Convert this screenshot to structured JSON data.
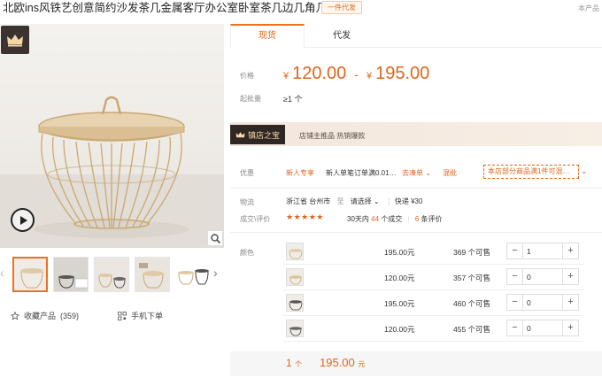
{
  "header": {
    "title": "北欧ins风铁艺创意简约沙发茶几金属客厅办公室卧室茶几边几角几",
    "dropship_tag": "一件代发",
    "this_product": "本产品"
  },
  "gallery": {
    "favorite_label": "收藏产品",
    "favorite_count": "(359)",
    "mobile_order_label": "手机下单",
    "thumbnail_count": 5,
    "icons": [
      "crown-icon",
      "play-icon",
      "zoom-icon",
      "star-outline-icon",
      "qr-code-icon"
    ]
  },
  "tabs": [
    {
      "label": "现货",
      "active": true
    },
    {
      "label": "代发",
      "active": false
    }
  ],
  "price": {
    "label": "价格",
    "currency": "¥",
    "low": "120.00",
    "separator": "-",
    "high": "195.00",
    "moq_label": "起批量",
    "moq_value": "≥1 个"
  },
  "store": {
    "badge": "镇店之宝",
    "text": "店铺主推品  热销爆款"
  },
  "promo": {
    "label": "优惠",
    "new_user": "新人专享",
    "desc": "新人单笔订单满0.01…",
    "link": "去凑单 ⌄",
    "mix": "混批",
    "store_offer": "本店部分商品满1件可混…",
    "more": "⌄"
  },
  "logistics": {
    "label": "物流",
    "from": "浙江省 台州市",
    "to": "至",
    "select": "请选择 ⌄",
    "express": "快递 ¥30"
  },
  "reviews": {
    "label": "成交\\评价",
    "stars": "★★★★★",
    "days_label": "30天内",
    "deals": "44",
    "deals_unit": "个成交",
    "reviews": "6",
    "reviews_unit": "条评价"
  },
  "variants": {
    "label": "颜色",
    "rows": [
      {
        "price": "195.00元",
        "stock": "369 个可售",
        "qty": "1"
      },
      {
        "price": "120.00元",
        "stock": "357 个可售",
        "qty": "0"
      },
      {
        "price": "195.00元",
        "stock": "460 个可售",
        "qty": "0"
      },
      {
        "price": "120.00元",
        "stock": "455 个可售",
        "qty": "0"
      }
    ]
  },
  "summary": {
    "count": "1",
    "count_unit": "个",
    "total": "195.00",
    "total_unit": "元"
  },
  "colors": {
    "accent": "#e0651c",
    "tab_border": "#f07020",
    "store_badge_bg": "#2f2724",
    "banner_bg": "#f3e7dc"
  }
}
